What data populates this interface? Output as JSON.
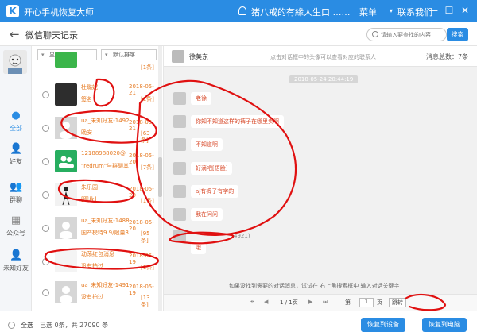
{
  "window": {
    "app_title": "开心手机恢复大师",
    "user_name": "猪八戒的有緣人生口 ……",
    "menu_label": "菜单",
    "contact_label": "联系我们",
    "minimize": "—",
    "maximize": "☐",
    "close": "✕"
  },
  "header": {
    "back": "←",
    "title": "微信聊天记录",
    "search_placeholder": "请输入要查找的内容",
    "search_button": "搜索"
  },
  "rail": {
    "items": [
      {
        "label": "全部",
        "icon": "chat-bubbles-icon",
        "active": true
      },
      {
        "label": "好友",
        "icon": "person-icon",
        "active": false
      },
      {
        "label": "群聊",
        "icon": "group-icon",
        "active": false
      },
      {
        "label": "公众号",
        "icon": "grid-icon",
        "active": false
      },
      {
        "label": "未知好友",
        "icon": "unknown-person-icon",
        "active": false
      }
    ]
  },
  "list": {
    "filter_display": "显示全部",
    "filter_sort": "默认排序",
    "contacts": [
      {
        "name": "",
        "date": "",
        "preview": "",
        "count": "[1条]"
      },
      {
        "name": "杜璐妮",
        "date": "2018-05-21",
        "preview": "签名",
        "count": "[1条]"
      },
      {
        "name": "ua_未知好友-1492",
        "date": "2018-05-21",
        "preview": "晚安",
        "count": "[63条]"
      },
      {
        "name": "12188988020@",
        "date": "2018-05-20",
        "preview": "\"redrum\"与群聊其…",
        "count": "[7条]"
      },
      {
        "name": "朱乐园",
        "date": "2018-05-20",
        "preview": "[图片]",
        "count": "[1条]"
      },
      {
        "name": "ua_未知好友-1488",
        "date": "2018-05-20",
        "preview": "国产模特9.9/限量3…",
        "count": "[95条]"
      },
      {
        "name": "动荡红包消息",
        "date": "2018-05-19",
        "preview": "没有拍过",
        "count": "[1条]"
      },
      {
        "name": "ua_未知好友-1491",
        "date": "2018-05-19",
        "preview": "没有拍过",
        "count": "[13条]"
      }
    ]
  },
  "chat": {
    "name": "徐美东",
    "hint": "点击对话框中的头像可以查看对应的联系人",
    "total": "消息总数：7条",
    "timestamp": "2018-05-24 20:44:19",
    "messages": [
      {
        "text": "老徐"
      },
      {
        "text": "你知不知道这样的裤子在哪里卖啊"
      },
      {
        "text": "不知道啊"
      },
      {
        "text": "好滴吧[捂脸]"
      },
      {
        "text": "aj有裤子有字的"
      },
      {
        "text": "我在问问"
      },
      {
        "text": "4921)"
      },
      {
        "text": "哦"
      }
    ],
    "footer_note": "如果没找到需要的对话消息，试试在 右上角搜索框中 输入对话关键字",
    "pager": {
      "first": "⏮",
      "prev": "◀",
      "page_info": "1 / 1页",
      "next": "▶",
      "last": "⏭",
      "goto_label": "第",
      "goto_value": "1",
      "goto_unit": "页",
      "go_button": "跳转"
    }
  },
  "bottom": {
    "select_all": "全选",
    "selected_info": "已选 0条，共 27090 条",
    "restore_device": "恢复到设备",
    "restore_pc": "恢复到电脑"
  },
  "colors": {
    "accent": "#2a8ce3",
    "orange_text": "#e67a22",
    "scribble_red": "#e01010"
  }
}
